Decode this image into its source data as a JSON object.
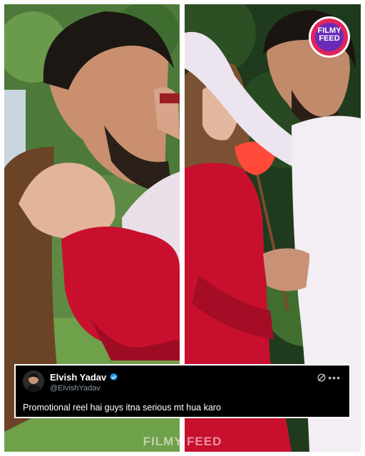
{
  "brand": {
    "badge_text": "FILMY FEED",
    "watermark_text": "FILMY FEED"
  },
  "tweet": {
    "author_name": "Elvish Yadav",
    "author_handle": "@ElvishYadav",
    "verified": true,
    "text": "Promotional reel hai guys itna serious mt hua karo"
  },
  "colors": {
    "dress_red": "#c8102e",
    "kurta_white": "#f2eef3",
    "foliage_green": "#3f6e2e",
    "tweet_bg": "#000000",
    "verified_blue": "#1d9bf0"
  }
}
